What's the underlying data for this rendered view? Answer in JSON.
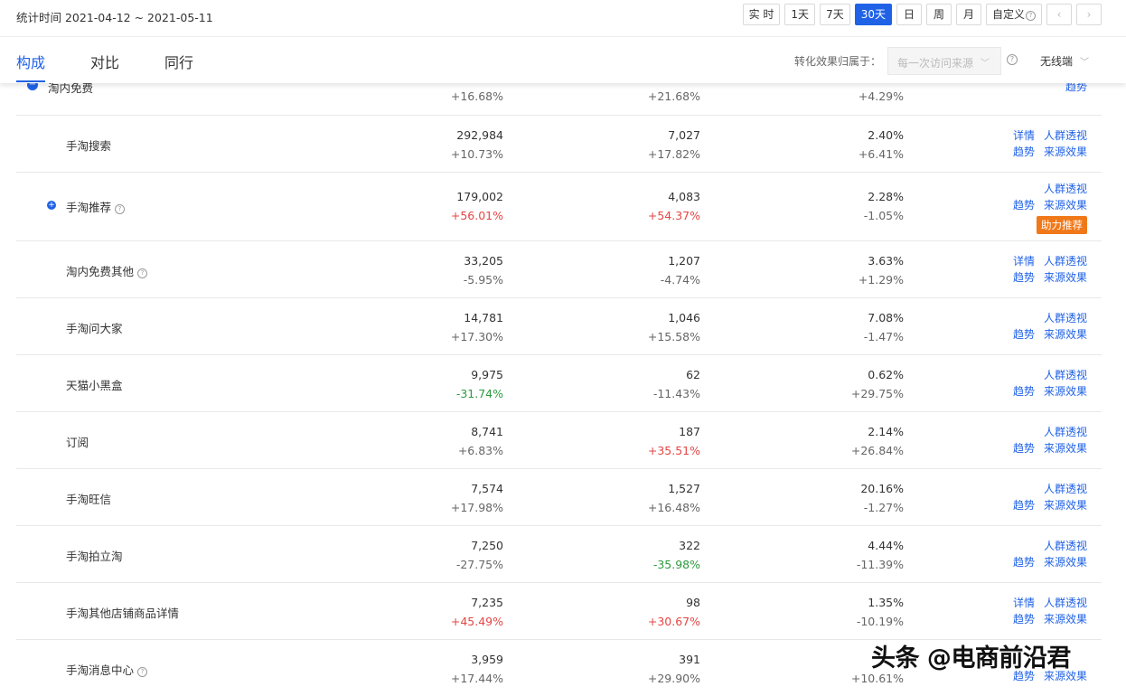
{
  "header": {
    "stat_time": "统计时间 2021-04-12 ~ 2021-05-11",
    "range_buttons": [
      "实 时",
      "1天",
      "7天",
      "30天",
      "日",
      "周",
      "月",
      "自定义"
    ],
    "nav_prev": "‹",
    "nav_next": "›",
    "help_glyph": "?"
  },
  "tabs": [
    "构成",
    "对比",
    "同行"
  ],
  "toolbar": {
    "attr_label": "转化效果归属于：",
    "attr_value": "每一次访问来源",
    "device": "无线端"
  },
  "group": {
    "name": "淘内免费",
    "values": [
      "+16.68%",
      "+21.68%",
      "+4.29%"
    ],
    "link": "趋势"
  },
  "link_labels": {
    "detail": "详情",
    "crowd": "人群透视",
    "trend": "趋势",
    "effect": "来源效果",
    "boost": "助力推荐"
  },
  "rows": [
    {
      "name": "手淘搜索",
      "v1": "292,984",
      "c1": "+10.73%",
      "v2": "7,027",
      "c2": "+17.82%",
      "v3": "2.40%",
      "c3": "+6.41%"
    },
    {
      "name": "手淘推荐",
      "v1": "179,002",
      "c1": "+56.01%",
      "v2": "4,083",
      "c2": "+54.37%",
      "v3": "2.28%",
      "c3": "-1.05%"
    },
    {
      "name": "淘内免费其他",
      "v1": "33,205",
      "c1": "-5.95%",
      "v2": "1,207",
      "c2": "-4.74%",
      "v3": "3.63%",
      "c3": "+1.29%"
    },
    {
      "name": "手淘问大家",
      "v1": "14,781",
      "c1": "+17.30%",
      "v2": "1,046",
      "c2": "+15.58%",
      "v3": "7.08%",
      "c3": "-1.47%"
    },
    {
      "name": "天猫小黑盒",
      "v1": "9,975",
      "c1": "-31.74%",
      "v2": "62",
      "c2": "-11.43%",
      "v3": "0.62%",
      "c3": "+29.75%"
    },
    {
      "name": "订阅",
      "v1": "8,741",
      "c1": "+6.83%",
      "v2": "187",
      "c2": "+35.51%",
      "v3": "2.14%",
      "c3": "+26.84%"
    },
    {
      "name": "手淘旺信",
      "v1": "7,574",
      "c1": "+17.98%",
      "v2": "1,527",
      "c2": "+16.48%",
      "v3": "20.16%",
      "c3": "-1.27%"
    },
    {
      "name": "手淘拍立淘",
      "v1": "7,250",
      "c1": "-27.75%",
      "v2": "322",
      "c2": "-35.98%",
      "v3": "4.44%",
      "c3": "-11.39%"
    },
    {
      "name": "手淘其他店铺商品详情",
      "v1": "7,235",
      "c1": "+45.49%",
      "v2": "98",
      "c2": "+30.67%",
      "v3": "1.35%",
      "c3": "-10.19%"
    },
    {
      "name": "手淘消息中心",
      "v1": "3,959",
      "c1": "+17.44%",
      "v2": "391",
      "c2": "+29.90%",
      "v3": "",
      "c3": "+10.61%"
    }
  ],
  "watermark": "头条 @电商前沿君",
  "colors": {
    "accent": "#2062e6",
    "up": "#e64545",
    "down": "#2c9b3e",
    "badge": "#f07818"
  }
}
